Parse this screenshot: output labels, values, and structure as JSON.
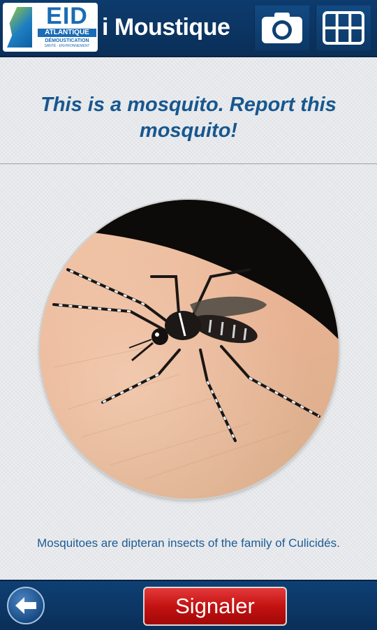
{
  "header": {
    "logo": {
      "name": "EID",
      "line1": "ATLANTIQUE",
      "line2": "DÉMOUSTICATION",
      "line3": "SANTÉ · ENVIRONNEMENT"
    },
    "app_title": "i Moustique",
    "buttons": [
      {
        "icon": "camera-icon"
      },
      {
        "icon": "grid-menu-icon"
      }
    ]
  },
  "main": {
    "heading": "This is a mosquito. Report this mosquito!",
    "image": {
      "icon": "mosquito-photo"
    },
    "caption": "Mosquitoes are dipteran insects of the family of Culicidés."
  },
  "footer": {
    "back": {
      "icon": "arrow-left-icon"
    },
    "report_label": "Signaler"
  },
  "colors": {
    "header_bg": "#0d3b6e",
    "heading_text": "#17578f",
    "report_button": "#c41212"
  }
}
